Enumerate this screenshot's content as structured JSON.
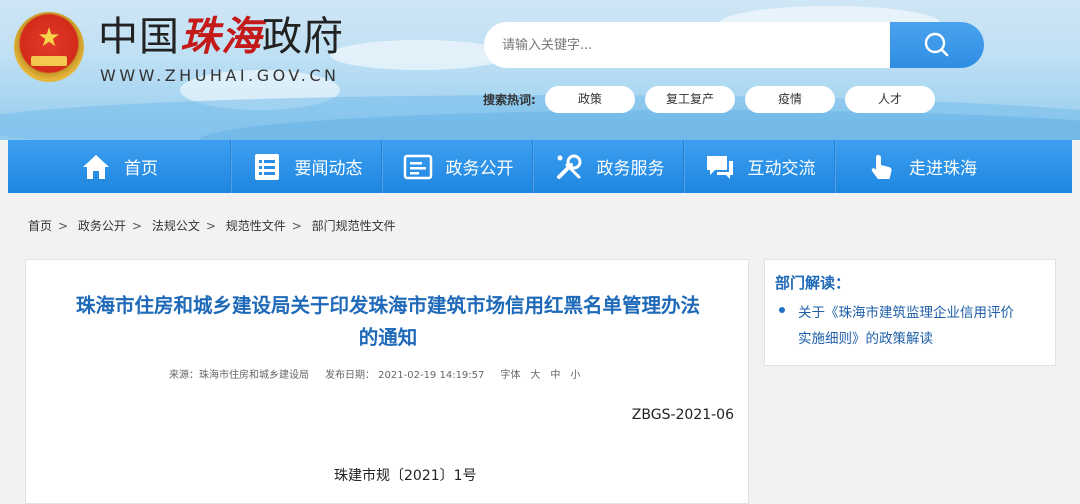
{
  "header": {
    "title_prefix": "中国",
    "title_calligraphy": "珠海",
    "title_suffix": "政府",
    "domain": "WWW.ZHUHAI.GOV.CN",
    "search_placeholder": "请输入关键字...",
    "search_icon": "search-icon",
    "hot_label": "搜索热词:",
    "hot_words": [
      "政策",
      "复工复产",
      "疫情",
      "人才"
    ]
  },
  "nav": {
    "items": [
      {
        "label": "首页",
        "icon": "home-icon"
      },
      {
        "label": "要闻动态",
        "icon": "news-list-icon"
      },
      {
        "label": "政务公开",
        "icon": "document-icon"
      },
      {
        "label": "政务服务",
        "icon": "tools-icon"
      },
      {
        "label": "互动交流",
        "icon": "chat-icon"
      },
      {
        "label": "走进珠海",
        "icon": "pointer-icon"
      }
    ]
  },
  "breadcrumb": [
    "首页",
    "政务公开",
    "法规公文",
    "规范性文件",
    "部门规范性文件"
  ],
  "article": {
    "title_line1": "珠海市住房和城乡建设局关于印发珠海市建筑市场信用红黑名单管理办法",
    "title_line2": "的通知",
    "source": "来源：珠海市住房和城乡建设局",
    "date": "发布日期： 2021-02-19 14:19:57",
    "font_label": "字体",
    "font_sizes": [
      "大",
      "中",
      "小"
    ],
    "doc_code": "ZBGS-2021-06",
    "doc_number": "珠建市规〔2021〕1号"
  },
  "sidebar": {
    "title": "部门解读：",
    "links": [
      {
        "line1": "关于《珠海市建筑监理企业信用评价",
        "line2": "实施细则》的政策解读"
      }
    ]
  },
  "colors": {
    "nav_blue": "#1e86e0",
    "title_blue": "#1e69b8",
    "link_blue": "#1e5fa8",
    "calligraphy_red": "#c41a1a"
  }
}
